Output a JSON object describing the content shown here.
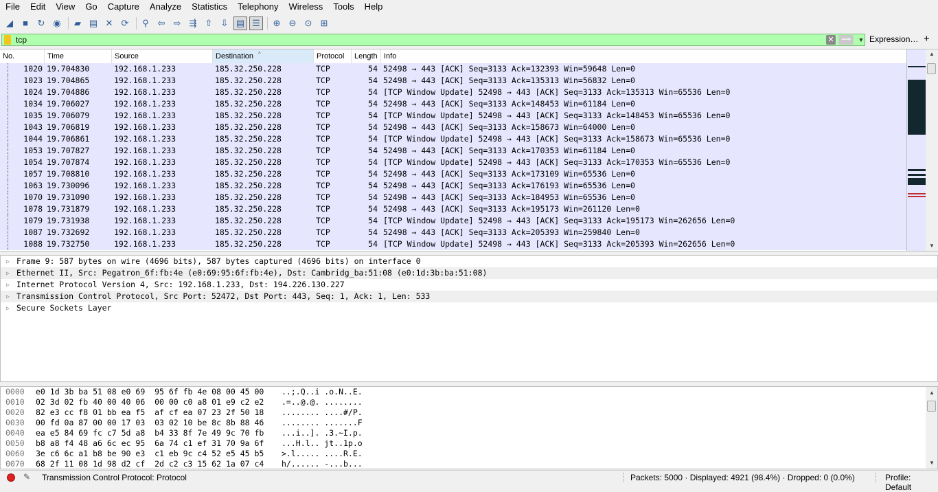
{
  "menu": [
    "File",
    "Edit",
    "View",
    "Go",
    "Capture",
    "Analyze",
    "Statistics",
    "Telephony",
    "Wireless",
    "Tools",
    "Help"
  ],
  "toolbar": [
    {
      "name": "start-capture-icon",
      "glyph": "◢"
    },
    {
      "name": "stop-capture-icon",
      "glyph": "■"
    },
    {
      "name": "restart-capture-icon",
      "glyph": "↻"
    },
    {
      "name": "capture-options-icon",
      "glyph": "◉"
    },
    {
      "sep": true
    },
    {
      "name": "open-file-icon",
      "glyph": "▰"
    },
    {
      "name": "save-file-icon",
      "glyph": "▤"
    },
    {
      "name": "close-file-icon",
      "glyph": "✕"
    },
    {
      "name": "reload-file-icon",
      "glyph": "⟳"
    },
    {
      "sep": true
    },
    {
      "name": "find-packet-icon",
      "glyph": "⚲"
    },
    {
      "name": "go-back-icon",
      "glyph": "⇦"
    },
    {
      "name": "go-forward-icon",
      "glyph": "⇨"
    },
    {
      "name": "go-to-packet-icon",
      "glyph": "⇶"
    },
    {
      "name": "go-first-packet-icon",
      "glyph": "⇧"
    },
    {
      "name": "go-last-packet-icon",
      "glyph": "⇩"
    },
    {
      "name": "auto-scroll-icon",
      "glyph": "▤",
      "active": true
    },
    {
      "name": "colorize-icon",
      "glyph": "☰",
      "active": true
    },
    {
      "sep": true
    },
    {
      "name": "zoom-in-icon",
      "glyph": "⊕"
    },
    {
      "name": "zoom-out-icon",
      "glyph": "⊖"
    },
    {
      "name": "zoom-normal-icon",
      "glyph": "⊙"
    },
    {
      "name": "resize-columns-icon",
      "glyph": "⊞"
    }
  ],
  "filter": {
    "value": "tcp",
    "expression_label": "Expression…",
    "add_label": "+"
  },
  "columns": {
    "no": "No.",
    "time": "Time",
    "source": "Source",
    "destination": "Destination",
    "protocol": "Protocol",
    "length": "Length",
    "info": "Info"
  },
  "packets": [
    {
      "no": "1020",
      "time": "19.704830",
      "src": "192.168.1.233",
      "dst": "185.32.250.228",
      "proto": "TCP",
      "len": "54",
      "info": "52498 → 443 [ACK] Seq=3133 Ack=132393 Win=59648 Len=0"
    },
    {
      "no": "1023",
      "time": "19.704865",
      "src": "192.168.1.233",
      "dst": "185.32.250.228",
      "proto": "TCP",
      "len": "54",
      "info": "52498 → 443 [ACK] Seq=3133 Ack=135313 Win=56832 Len=0"
    },
    {
      "no": "1024",
      "time": "19.704886",
      "src": "192.168.1.233",
      "dst": "185.32.250.228",
      "proto": "TCP",
      "len": "54",
      "info": "[TCP Window Update] 52498 → 443 [ACK] Seq=3133 Ack=135313 Win=65536 Len=0"
    },
    {
      "no": "1034",
      "time": "19.706027",
      "src": "192.168.1.233",
      "dst": "185.32.250.228",
      "proto": "TCP",
      "len": "54",
      "info": "52498 → 443 [ACK] Seq=3133 Ack=148453 Win=61184 Len=0"
    },
    {
      "no": "1035",
      "time": "19.706079",
      "src": "192.168.1.233",
      "dst": "185.32.250.228",
      "proto": "TCP",
      "len": "54",
      "info": "[TCP Window Update] 52498 → 443 [ACK] Seq=3133 Ack=148453 Win=65536 Len=0"
    },
    {
      "no": "1043",
      "time": "19.706819",
      "src": "192.168.1.233",
      "dst": "185.32.250.228",
      "proto": "TCP",
      "len": "54",
      "info": "52498 → 443 [ACK] Seq=3133 Ack=158673 Win=64000 Len=0"
    },
    {
      "no": "1044",
      "time": "19.706861",
      "src": "192.168.1.233",
      "dst": "185.32.250.228",
      "proto": "TCP",
      "len": "54",
      "info": "[TCP Window Update] 52498 → 443 [ACK] Seq=3133 Ack=158673 Win=65536 Len=0"
    },
    {
      "no": "1053",
      "time": "19.707827",
      "src": "192.168.1.233",
      "dst": "185.32.250.228",
      "proto": "TCP",
      "len": "54",
      "info": "52498 → 443 [ACK] Seq=3133 Ack=170353 Win=61184 Len=0"
    },
    {
      "no": "1054",
      "time": "19.707874",
      "src": "192.168.1.233",
      "dst": "185.32.250.228",
      "proto": "TCP",
      "len": "54",
      "info": "[TCP Window Update] 52498 → 443 [ACK] Seq=3133 Ack=170353 Win=65536 Len=0"
    },
    {
      "no": "1057",
      "time": "19.708810",
      "src": "192.168.1.233",
      "dst": "185.32.250.228",
      "proto": "TCP",
      "len": "54",
      "info": "52498 → 443 [ACK] Seq=3133 Ack=173109 Win=65536 Len=0"
    },
    {
      "no": "1063",
      "time": "19.730096",
      "src": "192.168.1.233",
      "dst": "185.32.250.228",
      "proto": "TCP",
      "len": "54",
      "info": "52498 → 443 [ACK] Seq=3133 Ack=176193 Win=65536 Len=0"
    },
    {
      "no": "1070",
      "time": "19.731090",
      "src": "192.168.1.233",
      "dst": "185.32.250.228",
      "proto": "TCP",
      "len": "54",
      "info": "52498 → 443 [ACK] Seq=3133 Ack=184953 Win=65536 Len=0"
    },
    {
      "no": "1078",
      "time": "19.731879",
      "src": "192.168.1.233",
      "dst": "185.32.250.228",
      "proto": "TCP",
      "len": "54",
      "info": "52498 → 443 [ACK] Seq=3133 Ack=195173 Win=261120 Len=0"
    },
    {
      "no": "1079",
      "time": "19.731938",
      "src": "192.168.1.233",
      "dst": "185.32.250.228",
      "proto": "TCP",
      "len": "54",
      "info": "[TCP Window Update] 52498 → 443 [ACK] Seq=3133 Ack=195173 Win=262656 Len=0"
    },
    {
      "no": "1087",
      "time": "19.732692",
      "src": "192.168.1.233",
      "dst": "185.32.250.228",
      "proto": "TCP",
      "len": "54",
      "info": "52498 → 443 [ACK] Seq=3133 Ack=205393 Win=259840 Len=0"
    },
    {
      "no": "1088",
      "time": "19.732750",
      "src": "192.168.1.233",
      "dst": "185.32.250.228",
      "proto": "TCP",
      "len": "54",
      "info": "[TCP Window Update] 52498 → 443 [ACK] Seq=3133 Ack=205393 Win=262656 Len=0"
    }
  ],
  "details": [
    "Frame 9: 587 bytes on wire (4696 bits), 587 bytes captured (4696 bits) on interface 0",
    "Ethernet II, Src: Pegatron_6f:fb:4e (e0:69:95:6f:fb:4e), Dst: Cambridg_ba:51:08 (e0:1d:3b:ba:51:08)",
    "Internet Protocol Version 4, Src: 192.168.1.233, Dst: 194.226.130.227",
    "Transmission Control Protocol, Src Port: 52472, Dst Port: 443, Seq: 1, Ack: 1, Len: 533",
    "Secure Sockets Layer"
  ],
  "bytes": [
    {
      "off": "0000",
      "hex": "e0 1d 3b ba 51 08 e0 69  95 6f fb 4e 08 00 45 00",
      "ascii": "..;.Q..i .o.N..E."
    },
    {
      "off": "0010",
      "hex": "02 3d 02 fb 40 00 40 06  00 00 c0 a8 01 e9 c2 e2",
      "ascii": ".=..@.@. ........"
    },
    {
      "off": "0020",
      "hex": "82 e3 cc f8 01 bb ea f5  af cf ea 07 23 2f 50 18",
      "ascii": "........ ....#/P."
    },
    {
      "off": "0030",
      "hex": "00 fd 0a 87 00 00 17 03  03 02 10 be 8c 8b 88 46",
      "ascii": "........ .......F"
    },
    {
      "off": "0040",
      "hex": "ea e5 84 69 fc c7 5d a8  b4 33 8f 7e 49 9c 70 fb",
      "ascii": "...i..]. .3.~I.p."
    },
    {
      "off": "0050",
      "hex": "b8 a8 f4 48 a6 6c ec 95  6a 74 c1 ef 31 70 9a 6f",
      "ascii": "...H.l.. jt..1p.o"
    },
    {
      "off": "0060",
      "hex": "3e c6 6c a1 b8 be 90 e3  c1 eb 9c c4 52 e5 45 b5",
      "ascii": ">.l..... ....R.E."
    },
    {
      "off": "0070",
      "hex": "68 2f 11 08 1d 98 d2 cf  2d c2 c3 15 62 1a 07 c4",
      "ascii": "h/...... -...b..."
    }
  ],
  "status": {
    "field_info": "Transmission Control Protocol: Protocol",
    "packets": "Packets: 5000 · Displayed: 4921 (98.4%) · Dropped: 0 (0.0%)",
    "profile": "Profile: Default"
  },
  "colors": {
    "row_bg": "#e7e6ff",
    "filter_ok": "#afffaf",
    "minimap_dark": "#12272e",
    "minimap_red": "#c03030"
  }
}
